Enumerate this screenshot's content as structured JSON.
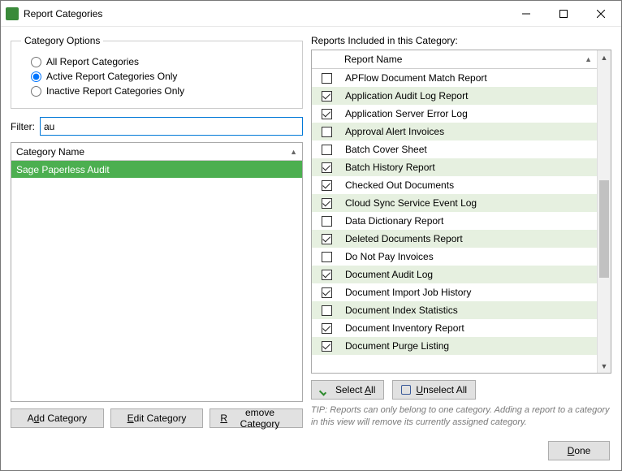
{
  "window": {
    "title": "Report Categories"
  },
  "category_options": {
    "legend": "Category Options"
  },
  "radios": {
    "all": "All Report Categories",
    "active": "Active Report Categories Only",
    "inactive": "Inactive Report Categories Only",
    "selected": "active"
  },
  "filter": {
    "label": "Filter:",
    "value": "au"
  },
  "cat_grid": {
    "header": "Category Name"
  },
  "cat_row": {
    "name": "Sage Paperless Audit"
  },
  "buttons": {
    "add_pre": "A",
    "add_u": "d",
    "add_post": "d Category",
    "edit_u": "E",
    "edit_post": "dit Category",
    "remove_u": "R",
    "remove_post": "emove Category",
    "selectall_pre": "Select ",
    "selectall_u": "A",
    "selectall_post": "ll",
    "unselect_u": "U",
    "unselect_post": "nselect All",
    "done_u": "D",
    "done_post": "one"
  },
  "reports_label": "Reports Included in this Category:",
  "reports_header": "Report Name",
  "reports": [
    {
      "name": "APFlow Document Match Report",
      "checked": false
    },
    {
      "name": "Application Audit Log Report",
      "checked": true
    },
    {
      "name": "Application Server Error Log",
      "checked": true
    },
    {
      "name": "Approval Alert Invoices",
      "checked": false
    },
    {
      "name": "Batch Cover Sheet",
      "checked": false
    },
    {
      "name": "Batch History Report",
      "checked": true
    },
    {
      "name": "Checked Out Documents",
      "checked": true
    },
    {
      "name": "Cloud Sync Service Event Log",
      "checked": true
    },
    {
      "name": "Data Dictionary Report",
      "checked": false
    },
    {
      "name": "Deleted Documents Report",
      "checked": true
    },
    {
      "name": "Do Not Pay Invoices",
      "checked": false
    },
    {
      "name": "Document Audit Log",
      "checked": true
    },
    {
      "name": "Document Import Job History",
      "checked": true
    },
    {
      "name": "Document Index Statistics",
      "checked": false
    },
    {
      "name": "Document Inventory Report",
      "checked": true
    },
    {
      "name": "Document Purge Listing",
      "checked": true
    }
  ],
  "tip": "TIP:  Reports can only belong to one category.  Adding a report to a category in this view will remove its currently assigned category."
}
